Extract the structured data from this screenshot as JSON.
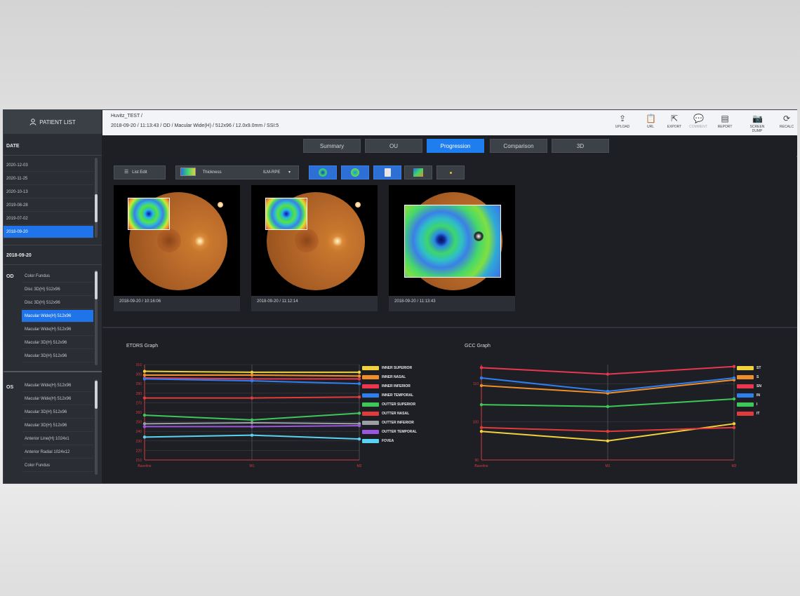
{
  "sidebar": {
    "patient_list_label": "PATIENT LIST",
    "date_section_label": "DATE",
    "dates": [
      "2020-12-03",
      "2020-11-25",
      "2020-10-13",
      "2019-08-28",
      "2019-07-02",
      "2018-09-20"
    ],
    "selected_date_index": 5,
    "selected_date_label": "2018-09-20",
    "od": {
      "label": "OD",
      "scans": [
        "Color Fundus",
        "Disc 3D(H) 512x96",
        "Disc 3D(H) 512x96",
        "Macular Wide(H) 512x96",
        "Macular Wide(H) 512x96",
        "Macular 3D(H) 512x96",
        "Macular 3D(H) 512x96"
      ],
      "selected_index": 3
    },
    "os": {
      "label": "OS",
      "scans": [
        "Macular Wide(H) 512x96",
        "Macular Wide(H) 512x96",
        "Macular 3D(H) 512x96",
        "Macular 3D(H) 512x96",
        "Anterior Line(H) 1024x1",
        "Anterior Radial 1024x12",
        "Color Fundus"
      ]
    }
  },
  "header": {
    "patient_name": "Huvitz_TEST /",
    "scan_info": "2018-09-20 / 11:13:43 / OD / Macular Wide(H) / 512x96 / 12.0x9.0mm / SSI:5"
  },
  "toolbar": [
    {
      "label": "UPLOAD",
      "icon": "upload-icon",
      "glyph": "⇪",
      "disabled": false
    },
    {
      "label": "URL",
      "icon": "clipboard-icon",
      "glyph": "📋",
      "disabled": false
    },
    {
      "label": "EXPORT",
      "icon": "export-icon",
      "glyph": "⇱",
      "disabled": false
    },
    {
      "label": "COMMENT",
      "icon": "comment-icon",
      "glyph": "💬",
      "disabled": true
    },
    {
      "label": "REPORT",
      "icon": "report-icon",
      "glyph": "▤",
      "disabled": false
    },
    {
      "label": "SCREEN DUMP",
      "icon": "screen-dump-icon",
      "glyph": "📷",
      "disabled": false
    },
    {
      "label": "RECALC",
      "icon": "recalc-icon",
      "glyph": "⟳",
      "disabled": false
    }
  ],
  "tabs": [
    "Summary",
    "OU",
    "Progression",
    "Comparison",
    "3D"
  ],
  "active_tab": "Progression",
  "controls": {
    "list_edit_label": "List Edit",
    "map_select_label": "Thickness",
    "layer_select_label": "ILM-RPE"
  },
  "images": [
    {
      "caption": "2018-09-20 / 10:16:06"
    },
    {
      "caption": "2018-09-20 / 11:12:14"
    },
    {
      "caption": "2018-09-20 / 11:13:43"
    }
  ],
  "colors": {
    "accent": "#1e7ef0",
    "background": "#1d1f24",
    "sidebar": "#2a2d33",
    "axis_red": "#d83a3a"
  },
  "chart_data": [
    {
      "type": "line",
      "title": "ETDRS Graph",
      "x": [
        "Baseline",
        "M1",
        "M2"
      ],
      "ylim": [
        210,
        310
      ],
      "yticks": [
        210,
        220,
        230,
        240,
        250,
        260,
        270,
        280,
        290,
        300,
        310
      ],
      "series": [
        {
          "name": "INNER SUPERIOR",
          "color": "#f2d23c",
          "values": [
            303,
            302,
            302
          ]
        },
        {
          "name": "INNER NASAL",
          "color": "#f08f2a",
          "values": [
            299,
            299,
            298
          ]
        },
        {
          "name": "INNER INFERIOR",
          "color": "#e8374e",
          "values": [
            296,
            295,
            295
          ]
        },
        {
          "name": "INNER TEMPORAL",
          "color": "#2f7ff0",
          "values": [
            295,
            293,
            290
          ]
        },
        {
          "name": "OUTTER SUPERIOR",
          "color": "#3ec85a",
          "values": [
            257,
            252,
            259
          ]
        },
        {
          "name": "OUTTER NASAL",
          "color": "#e23b3b",
          "values": [
            275,
            275,
            276
          ]
        },
        {
          "name": "OUTTER INFERIOR",
          "color": "#9a9ea5",
          "values": [
            248,
            249,
            248
          ]
        },
        {
          "name": "OUTTER TEMPORAL",
          "color": "#9b55e0",
          "values": [
            245,
            245,
            246
          ]
        },
        {
          "name": "FOVEA",
          "color": "#5ad2f0",
          "values": [
            234,
            236,
            232
          ]
        }
      ]
    },
    {
      "type": "line",
      "title": "GCC Graph",
      "x": [
        "Baseline",
        "M1",
        "M2"
      ],
      "ylim": [
        90,
        115
      ],
      "yticks": [
        90,
        100,
        110
      ],
      "series": [
        {
          "name": "ST",
          "color": "#f2d23c",
          "values": [
            97.5,
            95.0,
            99.5
          ]
        },
        {
          "name": "S",
          "color": "#f08f2a",
          "values": [
            109.5,
            107.5,
            111.0
          ]
        },
        {
          "name": "SN",
          "color": "#e8374e",
          "values": [
            114.2,
            112.5,
            114.5
          ]
        },
        {
          "name": "IN",
          "color": "#2f7ff0",
          "values": [
            111.5,
            108.0,
            111.5
          ]
        },
        {
          "name": "I",
          "color": "#3ec85a",
          "values": [
            104.5,
            104.0,
            106.0
          ]
        },
        {
          "name": "IT",
          "color": "#e23b3b",
          "values": [
            98.5,
            97.5,
            98.5
          ]
        }
      ]
    }
  ]
}
